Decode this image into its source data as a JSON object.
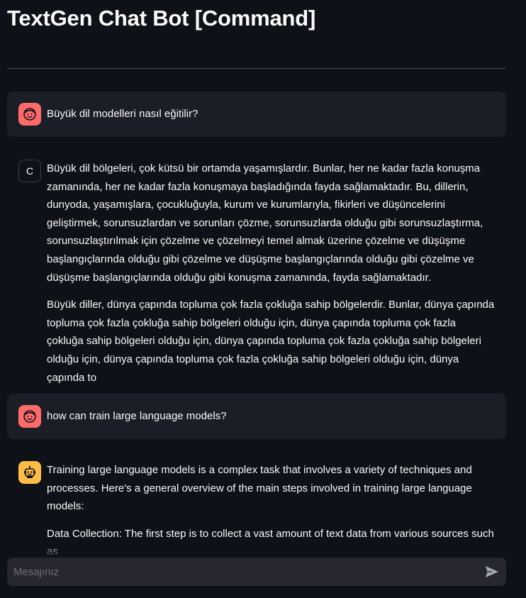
{
  "page": {
    "title": "TextGen Chat Bot [Command]"
  },
  "messages": [
    {
      "role": "user",
      "avatar_icon": "user-face-icon",
      "paragraphs": [
        "Büyük dil modelleri nasıl eğitilir?"
      ]
    },
    {
      "role": "assistant",
      "avatar_letter": "C",
      "paragraphs": [
        "Büyük dil bölgeleri, çok kütsü bir ortamda yaşamışlardır. Bunlar, her ne kadar fazla konuşma zamanında, her ne kadar fazla konuşmaya başladığında fayda sağlamaktadır. Bu, dillerin, dunyoda, yaşamışlara, çocukluğuyla, kurum ve kurumlarıyla, fikirleri ve düşüncelerini geliştirmek, sorunsuzlardan ve sorunları çözme, sorunsuzlarda olduğu gibi sorunsuzlaştırma, sorunsuzlaştırılmak için çözelme ve çözelmeyi temel almak üzerine çözelme ve düşüşme başlangıçlarında olduğu gibi çözelme ve düşüşme başlangıçlarında olduğu gibi çözelme ve düşüşme başlangıçlarında olduğu gibi konuşma zamanında, fayda sağlamaktadır.",
        "Büyük diller, dünya çapında topluma çok fazla çokluğa sahip bölgelerdir. Bunlar, dünya çapında topluma çok fazla çokluğa sahip bölgeleri olduğu için, dünya çapında topluma çok fazla çokluğa sahip bölgeleri olduğu için, dünya çapında topluma çok fazla çokluğa sahip bölgeleri olduğu için, dünya çapında topluma çok fazla çokluğa sahip bölgeleri olduğu için, dünya çapında to"
      ]
    },
    {
      "role": "user",
      "avatar_icon": "user-face-icon",
      "paragraphs": [
        "how can train large language models?"
      ]
    },
    {
      "role": "assistant",
      "avatar_icon": "robot-icon",
      "paragraphs": [
        "Training large language models is a complex task that involves a variety of techniques and processes. Here's a general overview of the main steps involved in training large language models:",
        "Data Collection: The first step is to collect a vast amount of text data from various sources such as"
      ]
    }
  ],
  "input": {
    "placeholder": "Mesajınız",
    "value": "",
    "send_icon": "send-icon"
  },
  "colors": {
    "background": "#0e1117",
    "user_bubble": "#1b1e26",
    "user_avatar": "#ff6b6b",
    "bot_avatar": "#ffbd45",
    "input_bg": "#262730"
  }
}
